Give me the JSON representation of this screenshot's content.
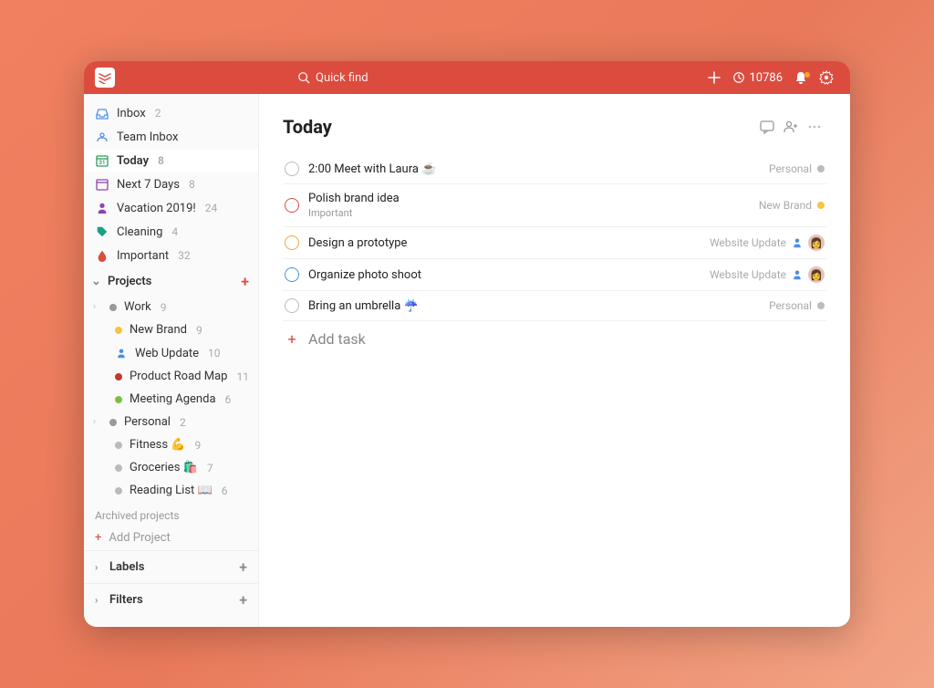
{
  "topbar": {
    "search_placeholder": "Quick find",
    "karma": "10786"
  },
  "sidebar": {
    "inbox": {
      "label": "Inbox",
      "count": "2"
    },
    "team_inbox": {
      "label": "Team Inbox"
    },
    "today": {
      "label": "Today",
      "count": "8"
    },
    "next7": {
      "label": "Next 7 Days",
      "count": "8"
    },
    "vacation": {
      "label": "Vacation 2019!",
      "count": "24"
    },
    "cleaning": {
      "label": "Cleaning",
      "count": "4"
    },
    "important": {
      "label": "Important",
      "count": "32"
    },
    "projects_header": "Projects",
    "work": {
      "label": "Work",
      "count": "9"
    },
    "new_brand": {
      "label": "New Brand",
      "count": "9"
    },
    "web_update": {
      "label": "Web Update",
      "count": "10"
    },
    "roadmap": {
      "label": "Product Road Map",
      "count": "11"
    },
    "meeting": {
      "label": "Meeting Agenda",
      "count": "6"
    },
    "personal": {
      "label": "Personal",
      "count": "2"
    },
    "fitness": {
      "label": "Fitness 💪",
      "count": "9"
    },
    "groceries": {
      "label": "Groceries 🛍️",
      "count": "7"
    },
    "reading": {
      "label": "Reading List 📖",
      "count": "6"
    },
    "archived": "Archived projects",
    "add_project": "Add Project",
    "labels": "Labels",
    "filters": "Filters"
  },
  "main": {
    "title": "Today",
    "add_task": "Add task",
    "tasks": [
      {
        "text": "2:00 Meet with Laura ☕",
        "sub": "",
        "project": "Personal",
        "dot": "#bbb",
        "check": "#bbb",
        "assignee": false,
        "avatar": false
      },
      {
        "text": "Polish brand idea",
        "sub": "Important",
        "project": "New Brand",
        "dot": "#f5c542",
        "check": "#db4c3f",
        "assignee": false,
        "avatar": false
      },
      {
        "text": "Design a prototype",
        "sub": "",
        "project": "Website Update",
        "dot": "",
        "check": "#f2a73b",
        "assignee": true,
        "avatar": true
      },
      {
        "text": "Organize photo shoot",
        "sub": "",
        "project": "Website Update",
        "dot": "",
        "check": "#4a90e2",
        "assignee": true,
        "avatar": true
      },
      {
        "text": "Bring an umbrella ☔",
        "sub": "",
        "project": "Personal",
        "dot": "#bbb",
        "check": "#bbb",
        "assignee": false,
        "avatar": false
      }
    ]
  },
  "colors": {
    "grey": "#999",
    "yellow": "#f5c542",
    "blue": "#4a90e2",
    "red": "#db4c3f",
    "green": "#7bc043",
    "darkred": "#c0392b",
    "orange": "#e67e22",
    "teal": "#16a085",
    "purple": "#8e44ad"
  }
}
